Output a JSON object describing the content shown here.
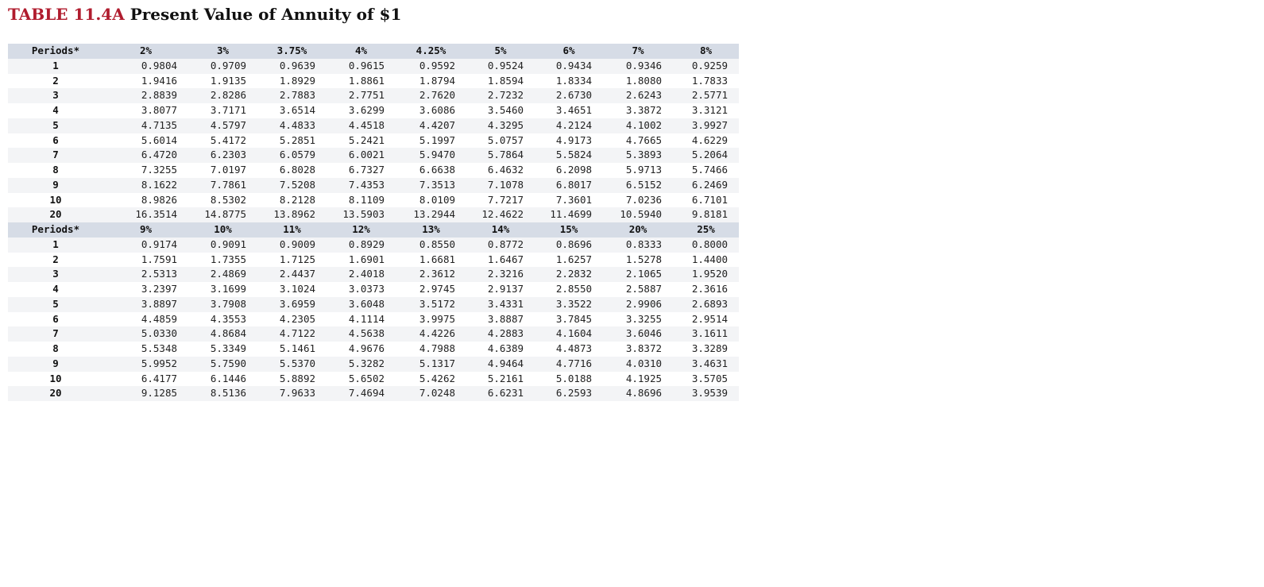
{
  "title": {
    "label": "TABLE 11.4A",
    "text": "Present Value of Annuity of $1"
  },
  "sections": [
    {
      "period_header": "Periods*",
      "rates": [
        "2%",
        "3%",
        "3.75%",
        "4%",
        "4.25%",
        "5%",
        "6%",
        "7%",
        "8%"
      ],
      "rows": [
        {
          "period": "1",
          "values": [
            "0.9804",
            "0.9709",
            "0.9639",
            "0.9615",
            "0.9592",
            "0.9524",
            "0.9434",
            "0.9346",
            "0.9259"
          ]
        },
        {
          "period": "2",
          "values": [
            "1.9416",
            "1.9135",
            "1.8929",
            "1.8861",
            "1.8794",
            "1.8594",
            "1.8334",
            "1.8080",
            "1.7833"
          ]
        },
        {
          "period": "3",
          "values": [
            "2.8839",
            "2.8286",
            "2.7883",
            "2.7751",
            "2.7620",
            "2.7232",
            "2.6730",
            "2.6243",
            "2.5771"
          ]
        },
        {
          "period": "4",
          "values": [
            "3.8077",
            "3.7171",
            "3.6514",
            "3.6299",
            "3.6086",
            "3.5460",
            "3.4651",
            "3.3872",
            "3.3121"
          ]
        },
        {
          "period": "5",
          "values": [
            "4.7135",
            "4.5797",
            "4.4833",
            "4.4518",
            "4.4207",
            "4.3295",
            "4.2124",
            "4.1002",
            "3.9927"
          ]
        },
        {
          "period": "6",
          "values": [
            "5.6014",
            "5.4172",
            "5.2851",
            "5.2421",
            "5.1997",
            "5.0757",
            "4.9173",
            "4.7665",
            "4.6229"
          ]
        },
        {
          "period": "7",
          "values": [
            "6.4720",
            "6.2303",
            "6.0579",
            "6.0021",
            "5.9470",
            "5.7864",
            "5.5824",
            "5.3893",
            "5.2064"
          ]
        },
        {
          "period": "8",
          "values": [
            "7.3255",
            "7.0197",
            "6.8028",
            "6.7327",
            "6.6638",
            "6.4632",
            "6.2098",
            "5.9713",
            "5.7466"
          ]
        },
        {
          "period": "9",
          "values": [
            "8.1622",
            "7.7861",
            "7.5208",
            "7.4353",
            "7.3513",
            "7.1078",
            "6.8017",
            "6.5152",
            "6.2469"
          ]
        },
        {
          "period": "10",
          "values": [
            "8.9826",
            "8.5302",
            "8.2128",
            "8.1109",
            "8.0109",
            "7.7217",
            "7.3601",
            "7.0236",
            "6.7101"
          ]
        },
        {
          "period": "20",
          "values": [
            "16.3514",
            "14.8775",
            "13.8962",
            "13.5903",
            "13.2944",
            "12.4622",
            "11.4699",
            "10.5940",
            "9.8181"
          ]
        }
      ]
    },
    {
      "period_header": "Periods*",
      "rates": [
        "9%",
        "10%",
        "11%",
        "12%",
        "13%",
        "14%",
        "15%",
        "20%",
        "25%"
      ],
      "rows": [
        {
          "period": "1",
          "values": [
            "0.9174",
            "0.9091",
            "0.9009",
            "0.8929",
            "0.8550",
            "0.8772",
            "0.8696",
            "0.8333",
            "0.8000"
          ]
        },
        {
          "period": "2",
          "values": [
            "1.7591",
            "1.7355",
            "1.7125",
            "1.6901",
            "1.6681",
            "1.6467",
            "1.6257",
            "1.5278",
            "1.4400"
          ]
        },
        {
          "period": "3",
          "values": [
            "2.5313",
            "2.4869",
            "2.4437",
            "2.4018",
            "2.3612",
            "2.3216",
            "2.2832",
            "2.1065",
            "1.9520"
          ]
        },
        {
          "period": "4",
          "values": [
            "3.2397",
            "3.1699",
            "3.1024",
            "3.0373",
            "2.9745",
            "2.9137",
            "2.8550",
            "2.5887",
            "2.3616"
          ]
        },
        {
          "period": "5",
          "values": [
            "3.8897",
            "3.7908",
            "3.6959",
            "3.6048",
            "3.5172",
            "3.4331",
            "3.3522",
            "2.9906",
            "2.6893"
          ]
        },
        {
          "period": "6",
          "values": [
            "4.4859",
            "4.3553",
            "4.2305",
            "4.1114",
            "3.9975",
            "3.8887",
            "3.7845",
            "3.3255",
            "2.9514"
          ]
        },
        {
          "period": "7",
          "values": [
            "5.0330",
            "4.8684",
            "4.7122",
            "4.5638",
            "4.4226",
            "4.2883",
            "4.1604",
            "3.6046",
            "3.1611"
          ]
        },
        {
          "period": "8",
          "values": [
            "5.5348",
            "5.3349",
            "5.1461",
            "4.9676",
            "4.7988",
            "4.6389",
            "4.4873",
            "3.8372",
            "3.3289"
          ]
        },
        {
          "period": "9",
          "values": [
            "5.9952",
            "5.7590",
            "5.5370",
            "5.3282",
            "5.1317",
            "4.9464",
            "4.7716",
            "4.0310",
            "3.4631"
          ]
        },
        {
          "period": "10",
          "values": [
            "6.4177",
            "6.1446",
            "5.8892",
            "5.6502",
            "5.4262",
            "5.2161",
            "5.0188",
            "4.1925",
            "3.5705"
          ]
        },
        {
          "period": "20",
          "values": [
            "9.1285",
            "8.5136",
            "7.9633",
            "7.4694",
            "7.0248",
            "6.6231",
            "6.2593",
            "4.8696",
            "3.9539"
          ]
        }
      ]
    }
  ],
  "colors": {
    "title_label": "#b01c2e",
    "header_bg": "#d6dce6",
    "stripe_bg": "#f3f4f6"
  }
}
